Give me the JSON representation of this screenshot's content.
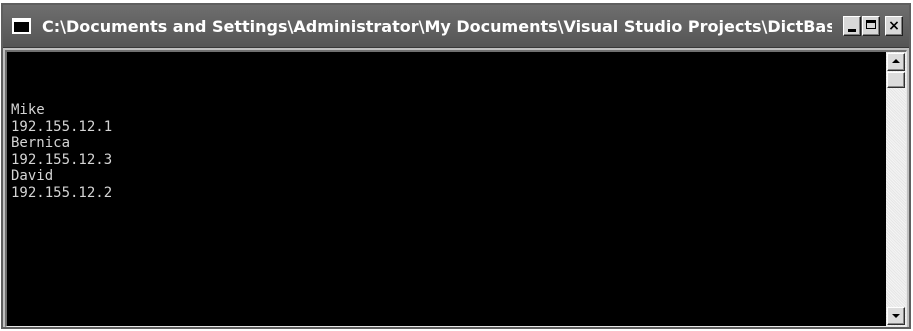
{
  "window": {
    "title": "C:\\Documents and Settings\\Administrator\\My Documents\\Visual Studio Projects\\DictBase\\bi...",
    "icon": "console-window-icon"
  },
  "controls": {
    "minimize_icon": "minimize-icon",
    "maximize_icon": "maximize-icon",
    "close_label": "×",
    "close_icon": "close-icon"
  },
  "console": {
    "lines": [
      "Mike",
      "192.155.12.1",
      "Bernica",
      "192.155.12.3",
      "David",
      "192.155.12.2"
    ]
  },
  "scrollbar": {
    "up_icon": "scroll-up-arrow-icon",
    "down_icon": "scroll-down-arrow-icon"
  },
  "colors": {
    "titlebar": "#5f5f5f",
    "console_background": "#000000",
    "console_text": "#d4d4d4"
  }
}
